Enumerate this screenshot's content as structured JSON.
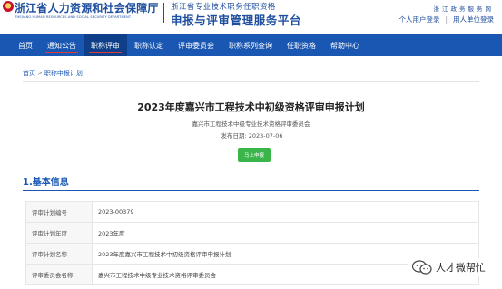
{
  "header": {
    "org_cn": "浙江省人力资源和社会保障厅",
    "org_en": "ZHEJIANG HUMAN RESOURCES AND SOCIAL SECURITY DEPARTMENT",
    "sys_sub": "浙江省专业技术职务任职资格",
    "sys_title": "申报与评审管理服务平台",
    "gov_name": "浙江政务服务网",
    "personal_login": "个人用户登录",
    "unit_login": "用人单位登录",
    "sep": "|"
  },
  "nav": {
    "items": [
      "首页",
      "通知公告",
      "职称评审",
      "职称认定",
      "评审委员会",
      "职称系列查询",
      "任职资格",
      "帮助中心"
    ]
  },
  "breadcrumb": {
    "home": "首页",
    "sep": ">",
    "current": "职称申报计划"
  },
  "doc": {
    "title": "2023年度嘉兴市工程技术中初级资格评审申报计划",
    "committee": "嘉兴市工程技术中级专业技术资格评审委员会",
    "date_label": "发布日期:",
    "date_value": "2023-07-06",
    "apply_button": "马上申报"
  },
  "section": {
    "title": "1.基本信息",
    "rows": [
      {
        "key": "评审计划编号",
        "value": "2023-00379"
      },
      {
        "key": "评审计划年度",
        "value": "2023年度"
      },
      {
        "key": "评审计划名称",
        "value": "2023年度嘉兴市工程技术中初级资格评审申报计划"
      },
      {
        "key": "评审委员会名称",
        "value": "嘉兴市工程技术中级专业技术资格评审委员会"
      }
    ]
  },
  "watermark": {
    "text": "人才微帮忙",
    "icon": "wechat-icon"
  },
  "colors": {
    "brand_blue": "#1a57b3",
    "apply_green": "#3ab54a",
    "active_underline": "#e03a3a"
  }
}
